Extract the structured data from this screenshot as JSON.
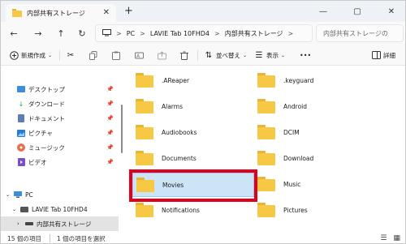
{
  "window": {
    "tab_title": "内部共有ストレージ",
    "new_tab": "+",
    "tab_close": "✕",
    "minimize": "—",
    "maximize": "▢",
    "close": "✕"
  },
  "nav": {
    "back": "←",
    "forward": "→",
    "up": "↑",
    "refresh": "↻"
  },
  "address": {
    "crumbs": [
      "PC",
      "LAVIE Tab 10FHD4",
      "内部共有ストレージ"
    ],
    "sep": ">",
    "expand": ">"
  },
  "search": {
    "placeholder": "内部共有ストレージの"
  },
  "commandbar": {
    "new_label": "新規作成",
    "sort_label": "並べ替え",
    "view_label": "表示",
    "more_label": "•••",
    "details_label": "詳細"
  },
  "sidebar": {
    "quick_access": [
      {
        "label": "デスクトップ",
        "icon": "desktop-icon"
      },
      {
        "label": "ダウンロード",
        "icon": "download-icon"
      },
      {
        "label": "ドキュメント",
        "icon": "document-icon"
      },
      {
        "label": "ピクチャ",
        "icon": "pictures-icon"
      },
      {
        "label": "ミュージック",
        "icon": "music-icon"
      },
      {
        "label": "ビデオ",
        "icon": "video-icon"
      }
    ],
    "pc_label": "PC",
    "device_label": "LAVIE Tab 10FHD4",
    "storage_label": "内部共有ストレージ"
  },
  "folders": {
    "left": [
      ".AReaper",
      "Alarms",
      "Audiobooks",
      "Documents",
      "Movies",
      "Notifications"
    ],
    "right": [
      ".keyguard",
      "Android",
      "DCIM",
      "Download",
      "Music",
      "Pictures"
    ]
  },
  "status": {
    "item_count": "15 個の項目",
    "selected_count": "1 個の項目を選択"
  },
  "colors": {
    "highlight": "#e0001b",
    "folder": "#f6c844",
    "selection": "#cce4f7"
  }
}
